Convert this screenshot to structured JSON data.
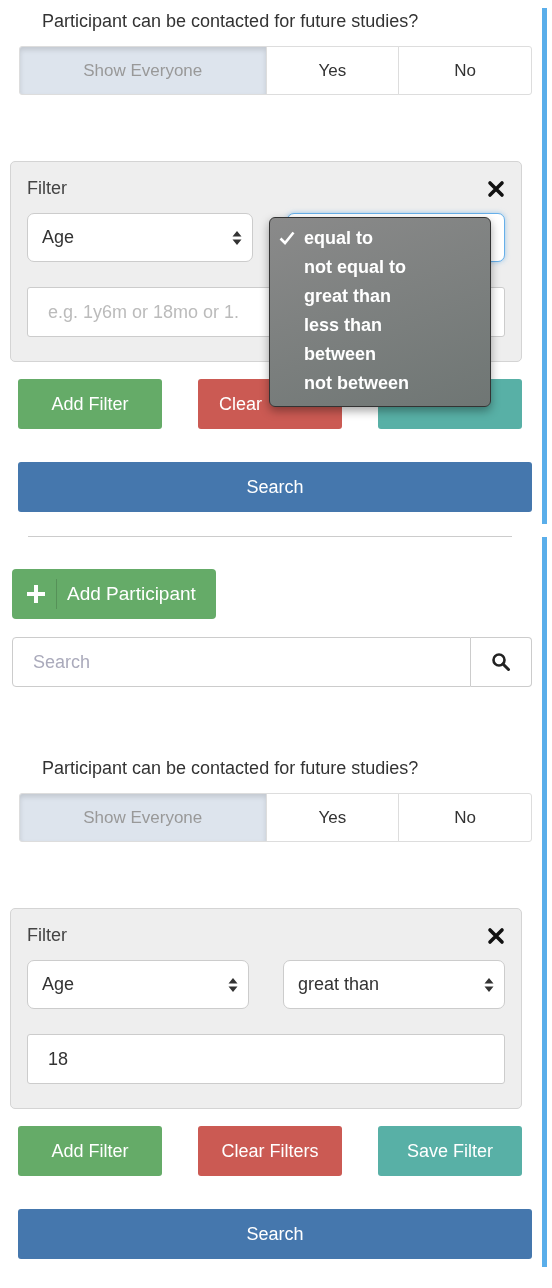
{
  "panels": [
    {
      "question": "Participant can be contacted for future studies?",
      "contact_options": [
        {
          "label": "Show Everyone",
          "selected": true
        },
        {
          "label": "Yes",
          "selected": false
        },
        {
          "label": "No",
          "selected": false
        }
      ],
      "filter": {
        "title": "Filter",
        "field": "Age",
        "value_field": {
          "placeholder": "e.g. 1y6m or 18mo or 1."
        },
        "operator_menu": [
          {
            "label": "equal to",
            "selected": true
          },
          {
            "label": "not equal to",
            "selected": false
          },
          {
            "label": "great than",
            "selected": false
          },
          {
            "label": "less than",
            "selected": false
          },
          {
            "label": "between",
            "selected": false
          },
          {
            "label": "not between",
            "selected": false
          }
        ]
      },
      "buttons": [
        {
          "kind": "add",
          "label": "Add Filter"
        },
        {
          "kind": "clear",
          "label": "Clear"
        },
        {
          "kind": "save"
        }
      ],
      "search_button": "Search"
    },
    {
      "add_participant": "Add Participant",
      "search": {
        "placeholder": "Search"
      },
      "question": "Participant can be contacted for future studies?",
      "contact_options": [
        {
          "label": "Show Everyone",
          "selected": true
        },
        {
          "label": "Yes",
          "selected": false
        },
        {
          "label": "No",
          "selected": false
        }
      ],
      "filter": {
        "title": "Filter",
        "field": "Age",
        "operator": "great than",
        "value_field": {
          "value": "18"
        }
      },
      "buttons": [
        {
          "kind": "add",
          "label": "Add Filter"
        },
        {
          "kind": "clear",
          "label": "Clear Filters"
        },
        {
          "kind": "save",
          "label": "Save Filter"
        }
      ],
      "search_button": "Search"
    }
  ]
}
